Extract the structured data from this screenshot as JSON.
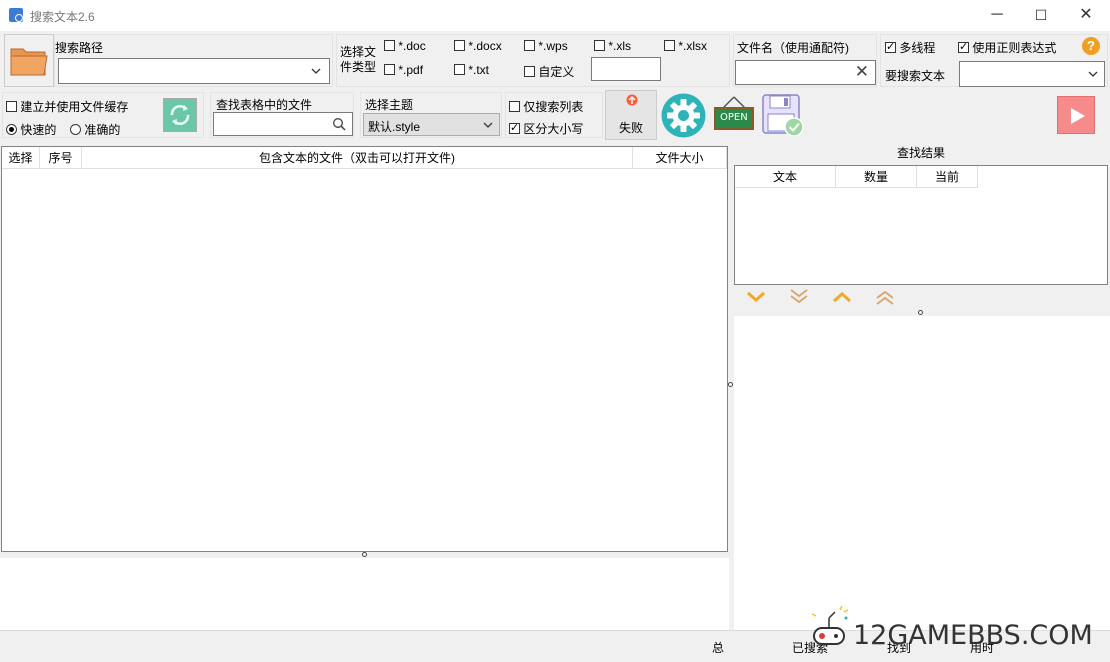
{
  "window": {
    "title": "搜索文本2.6",
    "minimize": "─",
    "maximize": "☐",
    "close": "✕"
  },
  "search_path": {
    "label": "搜索路径",
    "value": ""
  },
  "file_type": {
    "label_line1": "选择文",
    "label_line2": "件类型",
    "options": [
      "*.doc",
      "*.docx",
      "*.wps",
      "*.xls",
      "*.xlsx",
      "*.pdf",
      "*.txt",
      "自定义"
    ],
    "custom_value": ""
  },
  "filename": {
    "label": "文件名（使用通配符)",
    "value": ""
  },
  "options": {
    "multithread": "多线程",
    "regex": "使用正则表达式",
    "help": "?"
  },
  "search_text": {
    "label": "要搜索文本",
    "value": ""
  },
  "cache": {
    "label": "建立并使用文件缓存",
    "fast": "快速的",
    "accurate": "准确的"
  },
  "find_in_table": {
    "label": "查找表格中的文件",
    "value": ""
  },
  "theme": {
    "label": "选择主题",
    "value": "默认.style"
  },
  "list_opts": {
    "only_list": "仅搜索列表",
    "case": "区分大小写"
  },
  "fail_button": "失败",
  "open_icon_text": "OPEN",
  "files_table": {
    "columns": [
      "选择",
      "序号",
      "包含文本的文件（双击可以打开文件)",
      "文件大小"
    ],
    "rows": []
  },
  "results": {
    "header": "查找结果",
    "columns": [
      "文本",
      "数量",
      "当前"
    ],
    "rows": []
  },
  "status": {
    "total": "总",
    "searched": "已搜索",
    "found": "找到",
    "time": "用时"
  },
  "watermark": "12GAMEBBS.COM",
  "colors": {
    "accent": "#2eb3b8",
    "play": "#f58b8b",
    "folder": "#f2a562",
    "arrows": "#f5a623"
  }
}
